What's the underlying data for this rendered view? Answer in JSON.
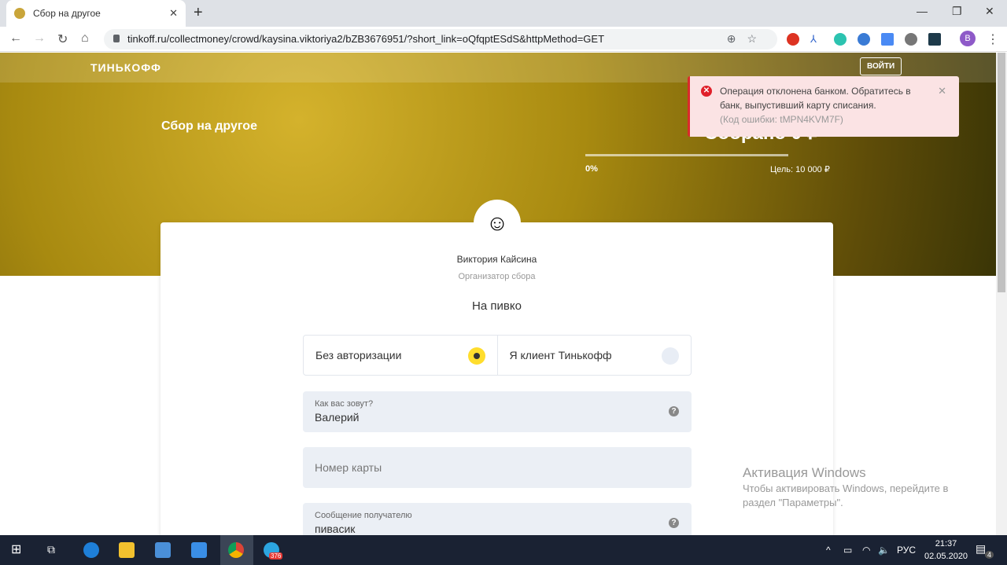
{
  "browser": {
    "tab_title": "Сбор на другое",
    "url": "tinkoff.ru/collectmoney/crowd/kaysina.viktoriya2/bZB3676951/?short_link=oQfqptESdS&httpMethod=GET",
    "profile": "B"
  },
  "header": {
    "logo": "ТИНЬКОФФ",
    "login": "ВОЙТИ"
  },
  "hero": {
    "title": "Сбор на другое",
    "collected": "Собрано 0 ₽",
    "progress_percent": 0,
    "progress_label": "0%",
    "goal": "Цель: 10 000 ₽"
  },
  "toast": {
    "message": "Операция отклонена банком. Обратитесь в банк, выпустивший карту списания.",
    "code": "(Код ошибки: tMPN4KVM7F)"
  },
  "card": {
    "avatar": "☺",
    "organizer_name": "Виктория Кайсина",
    "organizer_role": "Организатор сбора",
    "purpose": "На пивко",
    "options": [
      {
        "label": "Без авторизации",
        "selected": true
      },
      {
        "label": "Я клиент Тинькофф",
        "selected": false
      }
    ],
    "name_field": {
      "label": "Как вас зовут?",
      "value": "Валерий"
    },
    "card_field": {
      "placeholder": "Номер карты"
    },
    "message_field": {
      "label": "Сообщение получателю",
      "value": "пивасик"
    }
  },
  "watermark": {
    "title": "Активация Windows",
    "text": "Чтобы активировать Windows, перейдите в раздел \"Параметры\"."
  },
  "taskbar": {
    "lang": "РУС",
    "time": "21:37",
    "date": "02.05.2020",
    "notifications": "4",
    "telegram_badge": "376"
  }
}
